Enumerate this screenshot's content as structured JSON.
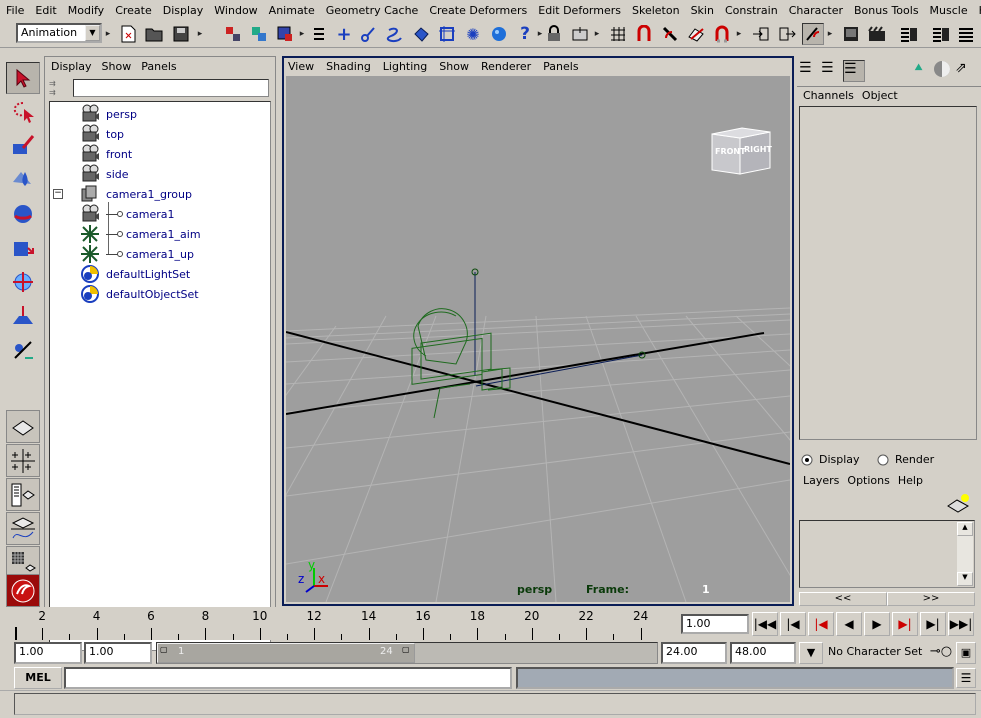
{
  "menubar": [
    "File",
    "Edit",
    "Modify",
    "Create",
    "Display",
    "Window",
    "Animate",
    "Geometry Cache",
    "Create Deformers",
    "Edit Deformers",
    "Skeleton",
    "Skin",
    "Constrain",
    "Character",
    "Bonus Tools",
    "Muscle",
    "Help"
  ],
  "statusline": {
    "menuset": "Animation"
  },
  "outliner": {
    "menu": [
      "Display",
      "Show",
      "Panels"
    ],
    "items": [
      {
        "label": "persp",
        "icon": "camera-icon"
      },
      {
        "label": "top",
        "icon": "camera-icon"
      },
      {
        "label": "front",
        "icon": "camera-icon"
      },
      {
        "label": "side",
        "icon": "camera-icon"
      },
      {
        "label": "camera1_group",
        "icon": "group-icon",
        "expanded": true
      },
      {
        "label": "camera1",
        "icon": "camera-icon",
        "child": true
      },
      {
        "label": "camera1_aim",
        "icon": "locator-icon",
        "child": true
      },
      {
        "label": "camera1_up",
        "icon": "locator-icon",
        "child": true
      },
      {
        "label": "defaultLightSet",
        "icon": "set-icon"
      },
      {
        "label": "defaultObjectSet",
        "icon": "set-icon"
      }
    ]
  },
  "viewport": {
    "menu": [
      "View",
      "Shading",
      "Lighting",
      "Show",
      "Renderer",
      "Panels"
    ],
    "camera_name": "persp",
    "frame_label": "Frame:",
    "frame_value": "1",
    "viewcube": {
      "front": "FRONT",
      "right": "RIGHT"
    },
    "axis": {
      "x": "x",
      "y": "y",
      "z": "z"
    }
  },
  "channelbox": {
    "menu": [
      "Channels",
      "Object"
    ]
  },
  "layereditor": {
    "display_label": "Display",
    "render_label": "Render",
    "menu": [
      "Layers",
      "Options",
      "Help"
    ],
    "scroll_left": "<<",
    "scroll_right": ">>"
  },
  "timeslider": {
    "ticks": [
      "2",
      "4",
      "6",
      "8",
      "10",
      "12",
      "14",
      "16",
      "18",
      "20",
      "22",
      "24"
    ],
    "current_time": "1.00"
  },
  "rangeslider": {
    "anim_start": "1.00",
    "playback_start": "1.00",
    "range_start_label": "1",
    "range_end_label": "24",
    "playback_end": "24.00",
    "anim_end": "48.00",
    "character_set": "No Character Set"
  },
  "cmdline": {
    "label": "MEL",
    "value": "",
    "result": ""
  },
  "colors": {
    "ui_gray": "#d4d0c8",
    "viewport_bg": "#9e9e9e",
    "wire_camera": "#1f6b1f",
    "outliner_text": "#000084",
    "active_panel_border": "#0a1d56"
  }
}
